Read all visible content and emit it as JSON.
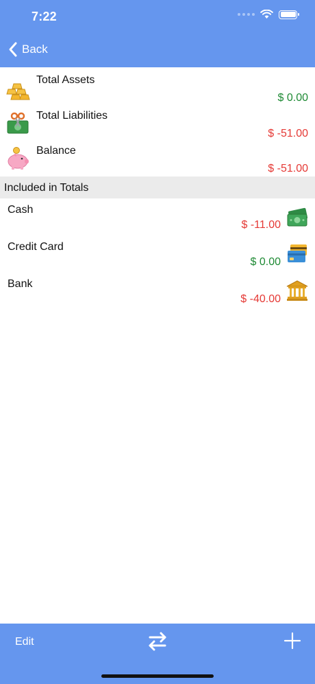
{
  "status_bar": {
    "time": "7:22"
  },
  "nav": {
    "back_label": "Back"
  },
  "summary": [
    {
      "label": "Total Assets",
      "value": "$ 0.00",
      "tone": "positive",
      "icon": "gold-bars-icon"
    },
    {
      "label": "Total Liabilities",
      "value": "$ -51.00",
      "tone": "negative",
      "icon": "cut-money-icon"
    },
    {
      "label": "Balance",
      "value": "$ -51.00",
      "tone": "negative",
      "icon": "piggy-bank-icon"
    }
  ],
  "section": {
    "title": "Included in Totals"
  },
  "accounts": [
    {
      "name": "Cash",
      "value": "$ -11.00",
      "tone": "negative",
      "icon": "cash-icon"
    },
    {
      "name": "Credit Card",
      "value": "$ 0.00",
      "tone": "positive",
      "icon": "credit-card-icon"
    },
    {
      "name": "Bank",
      "value": "$ -40.00",
      "tone": "negative",
      "icon": "bank-icon"
    }
  ],
  "toolbar": {
    "edit_label": "Edit"
  },
  "colors": {
    "accent": "#6596ee",
    "positive": "#1e8a34",
    "negative": "#e53935",
    "section_bg": "#ebebeb"
  }
}
